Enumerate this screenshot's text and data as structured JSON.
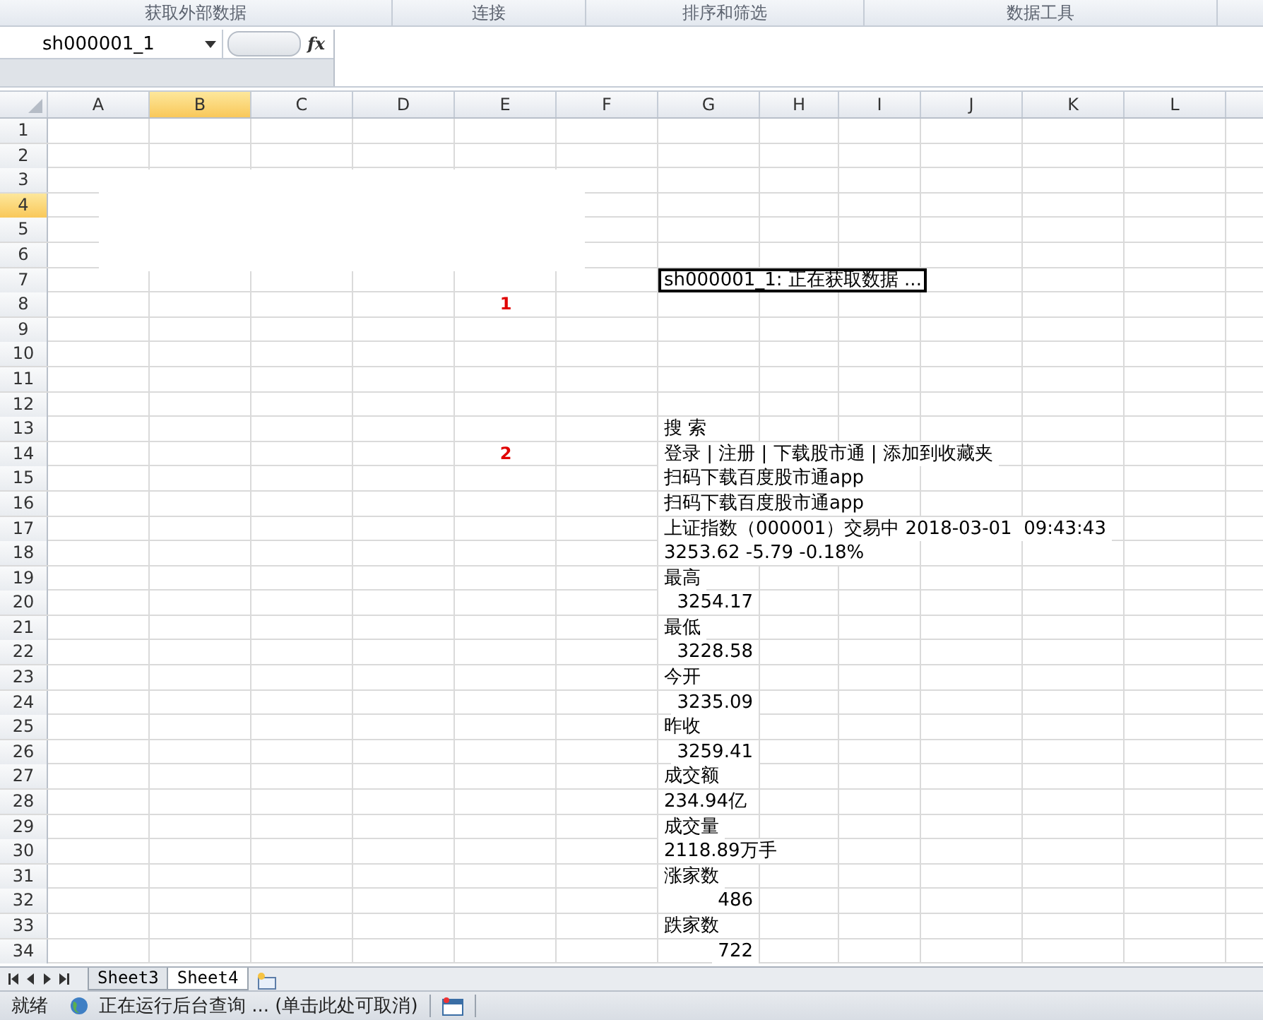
{
  "ribbon_groups": [
    "获取外部数据",
    "连接",
    "排序和筛选",
    "数据工具"
  ],
  "name_box": "sh000001_1",
  "formula_label": "fx",
  "columns": [
    {
      "label": "A",
      "selected": false
    },
    {
      "label": "B",
      "selected": true
    },
    {
      "label": "C",
      "selected": false
    },
    {
      "label": "D",
      "selected": false
    },
    {
      "label": "E",
      "selected": false
    },
    {
      "label": "F",
      "selected": false
    },
    {
      "label": "G",
      "selected": false
    },
    {
      "label": "H",
      "selected": false
    },
    {
      "label": "I",
      "selected": false
    },
    {
      "label": "J",
      "selected": false
    },
    {
      "label": "K",
      "selected": false
    },
    {
      "label": "L",
      "selected": false
    }
  ],
  "rows": [
    {
      "header": "1",
      "selected": false
    },
    {
      "header": "2",
      "selected": false
    },
    {
      "header": "3",
      "selected": false
    },
    {
      "header": "4",
      "selected": true
    },
    {
      "header": "5",
      "selected": false
    },
    {
      "header": "6",
      "selected": false
    },
    {
      "header": "7",
      "selected": false,
      "value": {
        "text": "sh000001_1: 正在获取数据 ...",
        "kind": "text",
        "selected": true
      }
    },
    {
      "header": "8",
      "selected": false,
      "marker": "1"
    },
    {
      "header": "9",
      "selected": false
    },
    {
      "header": "10",
      "selected": false
    },
    {
      "header": "11",
      "selected": false
    },
    {
      "header": "12",
      "selected": false
    },
    {
      "header": "13",
      "selected": false,
      "value": {
        "text": "搜 索",
        "kind": "text",
        "selected": false
      }
    },
    {
      "header": "14",
      "selected": false,
      "marker": "2",
      "value": {
        "text": "登录 | 注册 | 下载股市通 | 添加到收藏夹",
        "kind": "text",
        "selected": false
      }
    },
    {
      "header": "15",
      "selected": false,
      "value": {
        "text": "扫码下载百度股市通app",
        "kind": "text",
        "selected": false
      }
    },
    {
      "header": "16",
      "selected": false,
      "value": {
        "text": "扫码下载百度股市通app",
        "kind": "text",
        "selected": false
      }
    },
    {
      "header": "17",
      "selected": false,
      "value": {
        "text": "上证指数（000001）交易中 2018-03-01  09:43:43",
        "kind": "text",
        "selected": false
      }
    },
    {
      "header": "18",
      "selected": false,
      "value": {
        "text": "3253.62 -5.79 -0.18%",
        "kind": "text",
        "selected": false
      }
    },
    {
      "header": "19",
      "selected": false,
      "value": {
        "text": "最高",
        "kind": "text",
        "selected": false
      }
    },
    {
      "header": "20",
      "selected": false,
      "value": {
        "text": "3254.17",
        "kind": "number",
        "selected": false
      }
    },
    {
      "header": "21",
      "selected": false,
      "value": {
        "text": "最低",
        "kind": "text",
        "selected": false
      }
    },
    {
      "header": "22",
      "selected": false,
      "value": {
        "text": "3228.58",
        "kind": "number",
        "selected": false
      }
    },
    {
      "header": "23",
      "selected": false,
      "value": {
        "text": "今开",
        "kind": "text",
        "selected": false
      }
    },
    {
      "header": "24",
      "selected": false,
      "value": {
        "text": "3235.09",
        "kind": "number",
        "selected": false
      }
    },
    {
      "header": "25",
      "selected": false,
      "value": {
        "text": "昨收",
        "kind": "text",
        "selected": false
      }
    },
    {
      "header": "26",
      "selected": false,
      "value": {
        "text": "3259.41",
        "kind": "number",
        "selected": false
      }
    },
    {
      "header": "27",
      "selected": false,
      "value": {
        "text": "成交额",
        "kind": "text",
        "selected": false
      }
    },
    {
      "header": "28",
      "selected": false,
      "value": {
        "text": "234.94亿",
        "kind": "text",
        "selected": false
      }
    },
    {
      "header": "29",
      "selected": false,
      "value": {
        "text": "成交量",
        "kind": "text",
        "selected": false
      }
    },
    {
      "header": "30",
      "selected": false,
      "value": {
        "text": "2118.89万手",
        "kind": "text",
        "selected": false
      }
    },
    {
      "header": "31",
      "selected": false,
      "value": {
        "text": "涨家数",
        "kind": "text",
        "selected": false
      }
    },
    {
      "header": "32",
      "selected": false,
      "value": {
        "text": "486",
        "kind": "number",
        "selected": false
      }
    },
    {
      "header": "33",
      "selected": false,
      "value": {
        "text": "跌家数",
        "kind": "text",
        "selected": false
      }
    },
    {
      "header": "34",
      "selected": false,
      "value": {
        "text": "722",
        "kind": "number",
        "selected": false
      }
    }
  ],
  "sheet_tabs": [
    {
      "label": "Sheet3",
      "selected": false
    },
    {
      "label": "Sheet4",
      "selected": true
    }
  ],
  "status_bar": {
    "ready": "就绪",
    "message": "正在运行后台查询 ... (单击此处可取消)"
  }
}
